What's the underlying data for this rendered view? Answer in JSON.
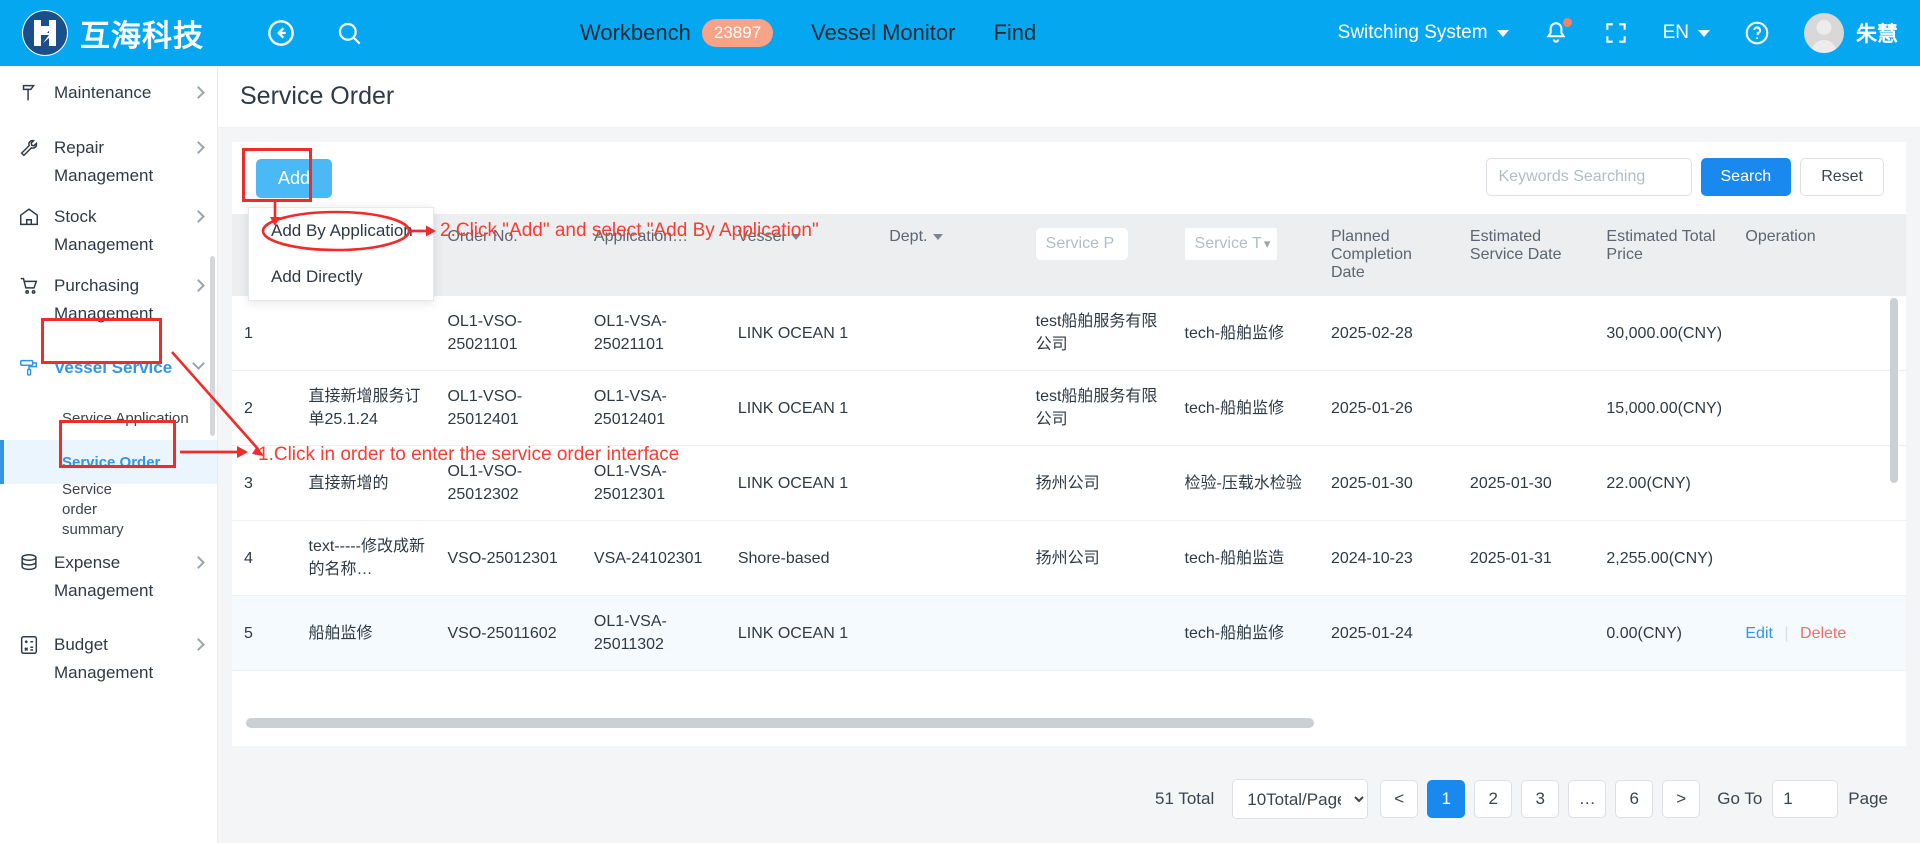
{
  "header": {
    "brand_name": "互海科技",
    "back_icon": "back-arrow-icon",
    "search_icon": "search-icon",
    "nav": [
      {
        "label": "Workbench",
        "badge": "23897"
      },
      {
        "label": "Vessel Monitor",
        "badge": ""
      },
      {
        "label": "Find",
        "badge": ""
      }
    ],
    "switching_system": "Switching System",
    "language": "EN",
    "user_name": "朱慧",
    "bell_icon": "bell-icon",
    "fullscreen_icon": "fullscreen-icon",
    "help_icon": "help-icon"
  },
  "sidebar": {
    "items": [
      {
        "label": "Maintenance",
        "icon": "hammer-icon",
        "expandable": true,
        "active": false
      },
      {
        "label": "Repair Management",
        "icon": "wrench-icon",
        "expandable": true,
        "active": false
      },
      {
        "label": "Stock Management",
        "icon": "warehouse-icon",
        "expandable": true,
        "active": false
      },
      {
        "label": "Purchasing Management",
        "icon": "cart-icon",
        "expandable": true,
        "active": false
      },
      {
        "label": "Vessel Service",
        "icon": "paint-roller-icon",
        "expandable": true,
        "active": true
      },
      {
        "label": "Expense Management",
        "icon": "database-icon",
        "expandable": true,
        "active": false
      },
      {
        "label": "Budget Management",
        "icon": "calculator-icon",
        "expandable": true,
        "active": false
      }
    ],
    "sub_items": [
      {
        "label": "Service Application",
        "selected": false
      },
      {
        "label": "Service Order",
        "selected": true
      },
      {
        "label": "Service order summary",
        "selected": false
      }
    ]
  },
  "page": {
    "title": "Service Order"
  },
  "toolbar": {
    "add_label": "Add",
    "search_placeholder": "Keywords Searching",
    "search_value": "",
    "search_label": "Search",
    "reset_label": "Reset"
  },
  "dropdown": {
    "items": [
      {
        "label": "Add By Application"
      },
      {
        "label": "Add Directly"
      }
    ]
  },
  "table": {
    "columns": [
      {
        "key": "idx",
        "label": "",
        "type": "plain"
      },
      {
        "key": "name",
        "label": "",
        "type": "plain"
      },
      {
        "key": "order_no",
        "label": "Order No.",
        "type": "plain"
      },
      {
        "key": "application",
        "label": "Application…",
        "type": "plain"
      },
      {
        "key": "vessel",
        "label": "Vessel",
        "type": "caret"
      },
      {
        "key": "dept",
        "label": "Dept.",
        "type": "caret"
      },
      {
        "key": "service_provider",
        "label": "Service P",
        "type": "filter"
      },
      {
        "key": "service_type",
        "label": "Service T",
        "type": "filter-chev"
      },
      {
        "key": "planned_completion_date",
        "label": "Planned Completion Date",
        "type": "plain"
      },
      {
        "key": "estimated_service_date",
        "label": "Estimated Service Date",
        "type": "plain"
      },
      {
        "key": "estimated_total_price",
        "label": "Estimated Total Price",
        "type": "plain"
      },
      {
        "key": "operation",
        "label": "Operation",
        "type": "plain"
      }
    ],
    "rows": [
      {
        "idx": "1",
        "name": "",
        "order_no": "OL1-VSO-25021101",
        "application": "OL1-VSA-25021101",
        "vessel": "LINK OCEAN 1",
        "dept": "",
        "service_provider": "test船舶服务有限公司",
        "service_type": "tech-船舶监修",
        "planned_completion_date": "2025-02-28",
        "estimated_service_date": "",
        "estimated_total_price": "30,000.00(CNY)",
        "op_edit": "",
        "op_delete": ""
      },
      {
        "idx": "2",
        "name": "直接新增服务订单25.1.24",
        "order_no": "OL1-VSO-25012401",
        "application": "OL1-VSA-25012401",
        "vessel": "LINK OCEAN 1",
        "dept": "",
        "service_provider": "test船舶服务有限公司",
        "service_type": "tech-船舶监修",
        "planned_completion_date": "2025-01-26",
        "estimated_service_date": "",
        "estimated_total_price": "15,000.00(CNY)",
        "op_edit": "",
        "op_delete": ""
      },
      {
        "idx": "3",
        "name": "直接新增的",
        "order_no": "OL1-VSO-25012302",
        "application": "OL1-VSA-25012301",
        "vessel": "LINK OCEAN 1",
        "dept": "",
        "service_provider": "扬州公司",
        "service_type": "检验-压载水检验",
        "planned_completion_date": "2025-01-30",
        "estimated_service_date": "2025-01-30",
        "estimated_total_price": "22.00(CNY)",
        "op_edit": "",
        "op_delete": ""
      },
      {
        "idx": "4",
        "name": "text-----修改成新的名称…",
        "order_no": "VSO-25012301",
        "application": "VSA-24102301",
        "vessel": "Shore-based",
        "dept": "",
        "service_provider": "扬州公司",
        "service_type": "tech-船舶监造",
        "planned_completion_date": "2024-10-23",
        "estimated_service_date": "2025-01-31",
        "estimated_total_price": "2,255.00(CNY)",
        "op_edit": "",
        "op_delete": ""
      },
      {
        "idx": "5",
        "name": "船舶监修",
        "order_no": "VSO-25011602",
        "application": "OL1-VSA-25011302",
        "vessel": "LINK OCEAN 1",
        "dept": "",
        "service_provider": "",
        "service_type": "tech-船舶监修",
        "planned_completion_date": "2025-01-24",
        "estimated_service_date": "",
        "estimated_total_price": "0.00(CNY)",
        "op_edit": "Edit",
        "op_delete": "Delete"
      }
    ]
  },
  "pagination": {
    "total_text": "51 Total",
    "page_size": "10Total/Page",
    "prev": "<",
    "pages": [
      "1",
      "2",
      "3",
      "…",
      "6"
    ],
    "current_page": "1",
    "next": ">",
    "goto_label": "Go To",
    "goto_value": "1",
    "page_label": "Page"
  },
  "annotations": [
    {
      "id": "a1",
      "text": "1.Click in order to enter the service order interface"
    },
    {
      "id": "a2",
      "text": "2.Click \"Add\" and select \"Add By Application\""
    }
  ],
  "colors": {
    "brand_blue": "#05a7f0",
    "accent_blue": "#1989ef",
    "add_blue": "#4ab9f5",
    "annotation_red": "#fb3b30",
    "badge_orange": "#f8a387",
    "delete_red": "#f56c6c"
  }
}
